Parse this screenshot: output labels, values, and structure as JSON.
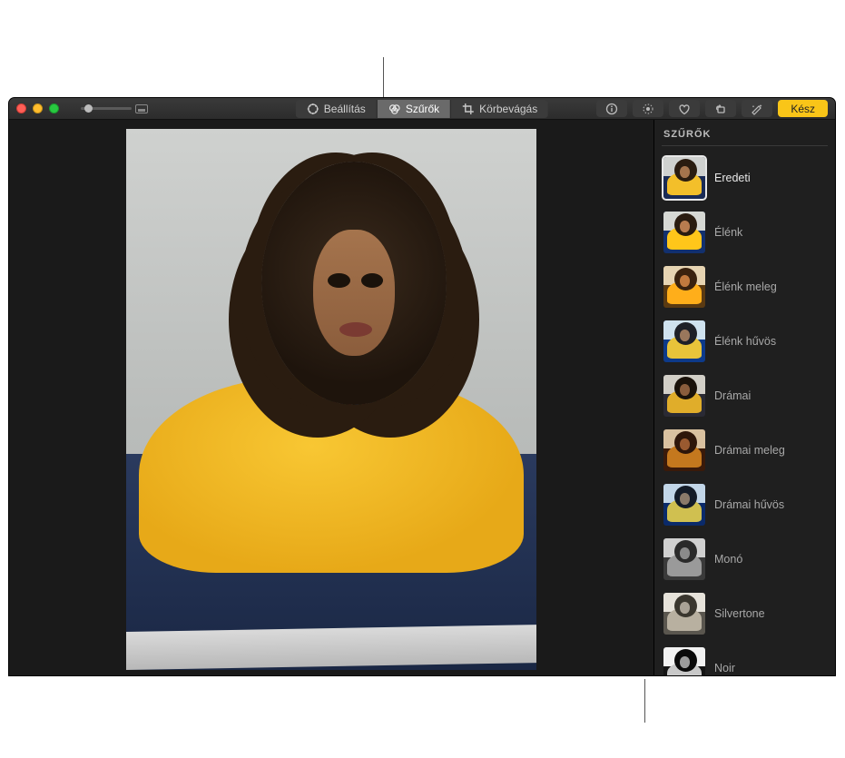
{
  "toolbar": {
    "adjust_label": "Beállítás",
    "filters_label": "Szűrők",
    "crop_label": "Körbevágás",
    "done_label": "Kész"
  },
  "panel": {
    "title": "SZŰRŐK",
    "filters": [
      {
        "label": "Eredeti",
        "selected": true,
        "sky": "#cfd1cf",
        "sw": "#f3bf2a",
        "hair": "#2a1c10",
        "face": "#a5744d",
        "bg": "#1a2b55"
      },
      {
        "label": "Élénk",
        "selected": false,
        "sky": "#d6d8d4",
        "sw": "#ffc61a",
        "hair": "#2a1c10",
        "face": "#b87c4f",
        "bg": "#12306e"
      },
      {
        "label": "Élénk meleg",
        "selected": false,
        "sky": "#e6d4b2",
        "sw": "#ffae1a",
        "hair": "#3a220e",
        "face": "#c27a3e",
        "bg": "#5a3a12"
      },
      {
        "label": "Élénk hűvös",
        "selected": false,
        "sky": "#cfe2ef",
        "sw": "#e8c43a",
        "hair": "#1e2028",
        "face": "#9a775c",
        "bg": "#0d3a8a"
      },
      {
        "label": "Drámai",
        "selected": false,
        "sky": "#d2cfc7",
        "sw": "#e0ad2a",
        "hair": "#1a120a",
        "face": "#8a5d3c",
        "bg": "#2a2a34"
      },
      {
        "label": "Drámai meleg",
        "selected": false,
        "sky": "#d9c1a0",
        "sw": "#c4781e",
        "hair": "#2e160a",
        "face": "#9a5a30",
        "bg": "#3a1a0a"
      },
      {
        "label": "Drámai hűvös",
        "selected": false,
        "sky": "#c2d6e8",
        "sw": "#d0c050",
        "hair": "#141c28",
        "face": "#8a7a6a",
        "bg": "#0a2a6a"
      },
      {
        "label": "Monó",
        "selected": false,
        "sky": "#d0d0d0",
        "sw": "#9a9a9a",
        "hair": "#2a2a2a",
        "face": "#8a8a8a",
        "bg": "#3a3a3a"
      },
      {
        "label": "Silvertone",
        "selected": false,
        "sky": "#e6e2da",
        "sw": "#b8b0a0",
        "hair": "#3a362e",
        "face": "#aaa296",
        "bg": "#5a564e"
      },
      {
        "label": "Noir",
        "selected": false,
        "sky": "#f2f2f2",
        "sw": "#c8c8c8",
        "hair": "#0a0a0a",
        "face": "#9c9c9c",
        "bg": "#141414"
      }
    ]
  }
}
